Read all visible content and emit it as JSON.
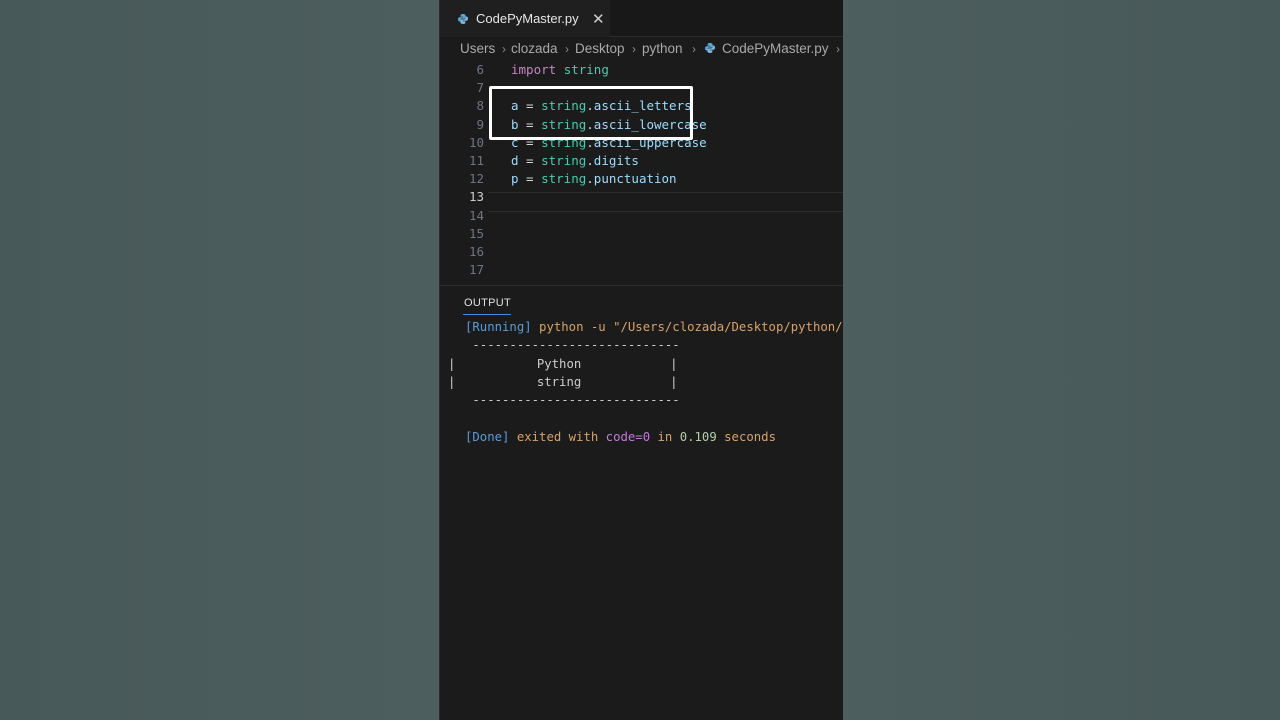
{
  "tab": {
    "filename": "CodePyMaster.py",
    "close": "✕"
  },
  "breadcrumb": [
    "Users",
    "clozada",
    "Desktop",
    "python",
    "CodePyMaster.py"
  ],
  "breadcrumb_separator": "›",
  "editor": {
    "lines": [
      {
        "n": "6",
        "tokens": [
          [
            "kw",
            "import"
          ],
          [
            "plain",
            " "
          ],
          [
            "mod",
            "string"
          ]
        ]
      },
      {
        "n": "7",
        "tokens": []
      },
      {
        "n": "8",
        "tokens": [
          [
            "var",
            "a"
          ],
          [
            "eq",
            " = "
          ],
          [
            "mod",
            "string"
          ],
          [
            "eq",
            "."
          ],
          [
            "fn",
            "ascii_letters"
          ]
        ]
      },
      {
        "n": "9",
        "tokens": [
          [
            "var",
            "b"
          ],
          [
            "eq",
            " = "
          ],
          [
            "mod",
            "string"
          ],
          [
            "eq",
            "."
          ],
          [
            "fn",
            "ascii_lowercase"
          ]
        ]
      },
      {
        "n": "10",
        "tokens": [
          [
            "var",
            "c"
          ],
          [
            "eq",
            " = "
          ],
          [
            "mod",
            "string"
          ],
          [
            "eq",
            "."
          ],
          [
            "fn",
            "ascii_uppercase"
          ]
        ]
      },
      {
        "n": "11",
        "tokens": [
          [
            "var",
            "d"
          ],
          [
            "eq",
            " = "
          ],
          [
            "mod",
            "string"
          ],
          [
            "eq",
            "."
          ],
          [
            "fn",
            "digits"
          ]
        ]
      },
      {
        "n": "12",
        "tokens": [
          [
            "var",
            "p"
          ],
          [
            "eq",
            " = "
          ],
          [
            "mod",
            "string"
          ],
          [
            "eq",
            "."
          ],
          [
            "fn",
            "punctuation"
          ]
        ]
      },
      {
        "n": "13",
        "tokens": []
      },
      {
        "n": "14",
        "tokens": []
      },
      {
        "n": "15",
        "tokens": []
      },
      {
        "n": "16",
        "tokens": []
      },
      {
        "n": "17",
        "tokens": []
      }
    ],
    "active_line": "13"
  },
  "panel": {
    "tab_label": "OUTPUT",
    "running_tag": "[Running]",
    "running_cmd": "python -u \"/Users/clozada/Desktop/python/C",
    "box_top": " ----------------------------",
    "box_line1": "|           Python            |",
    "box_line2": "|           string            |",
    "box_bottom": " ----------------------------",
    "done_tag": "[Done]",
    "done_text1": "exited with",
    "done_code": "code=0",
    "done_text2": "in",
    "done_time": "0.109",
    "done_text3": "seconds"
  },
  "colors": {
    "keyword": "#c586c0",
    "module": "#4ec9b0",
    "variable": "#9cdcfe",
    "output_tag": "#5b9bd5",
    "output_cmd": "#d7a26a",
    "highlight_box": "#ffffff"
  },
  "icons": {
    "tab_icon": "python-file-icon",
    "breadcrumb_icon": "python-file-icon"
  }
}
